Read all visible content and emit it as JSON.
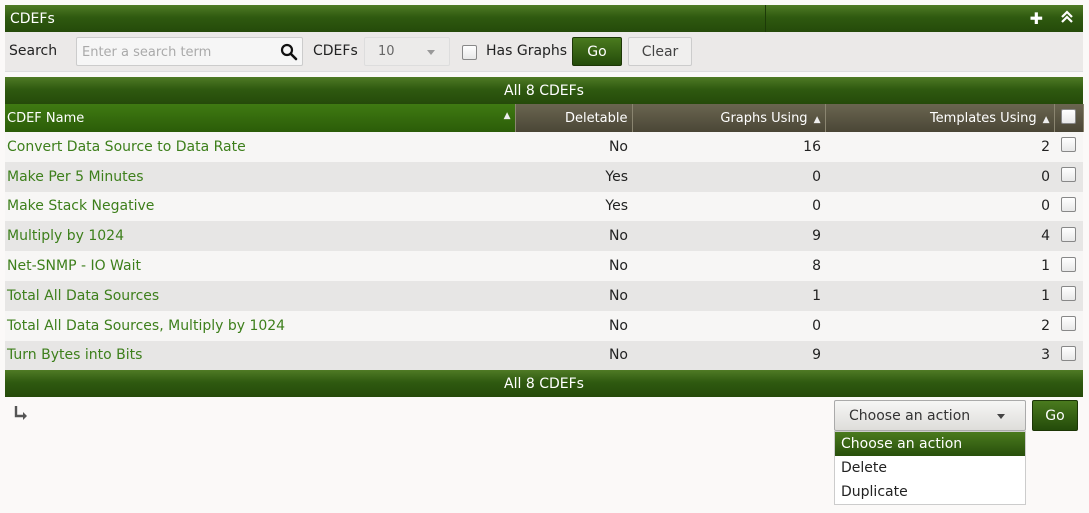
{
  "header": {
    "title": "CDEFs",
    "add_icon": "plus-icon",
    "collapse_icon": "double-chevron-up-icon"
  },
  "filter": {
    "search_label": "Search",
    "search_placeholder": "Enter a search term",
    "rows_label": "CDEFs",
    "rows_value": "10",
    "has_graphs_label": "Has Graphs",
    "has_graphs_checked": false,
    "go_label": "Go",
    "clear_label": "Clear"
  },
  "nav": {
    "top_text": "All 8 CDEFs",
    "bottom_text": "All 8 CDEFs"
  },
  "table": {
    "columns": [
      "CDEF Name",
      "Deletable",
      "Graphs Using",
      "Templates Using"
    ],
    "rows": [
      {
        "name": "Convert Data Source to Data Rate",
        "deletable": "No",
        "graphs": "16",
        "templates": "2"
      },
      {
        "name": "Make Per 5 Minutes",
        "deletable": "Yes",
        "graphs": "0",
        "templates": "0"
      },
      {
        "name": "Make Stack Negative",
        "deletable": "Yes",
        "graphs": "0",
        "templates": "0"
      },
      {
        "name": "Multiply by 1024",
        "deletable": "No",
        "graphs": "9",
        "templates": "4"
      },
      {
        "name": "Net-SNMP - IO Wait",
        "deletable": "No",
        "graphs": "8",
        "templates": "1"
      },
      {
        "name": "Total All Data Sources",
        "deletable": "No",
        "graphs": "1",
        "templates": "1"
      },
      {
        "name": "Total All Data Sources, Multiply by 1024",
        "deletable": "No",
        "graphs": "0",
        "templates": "2"
      },
      {
        "name": "Turn Bytes into Bits",
        "deletable": "No",
        "graphs": "9",
        "templates": "3"
      }
    ]
  },
  "actions": {
    "selected": "Choose an action",
    "go_label": "Go",
    "options": [
      "Choose an action",
      "Delete",
      "Duplicate"
    ]
  },
  "colors": {
    "accent_green": "#2f5a10",
    "link_green": "#3d7f1b"
  }
}
